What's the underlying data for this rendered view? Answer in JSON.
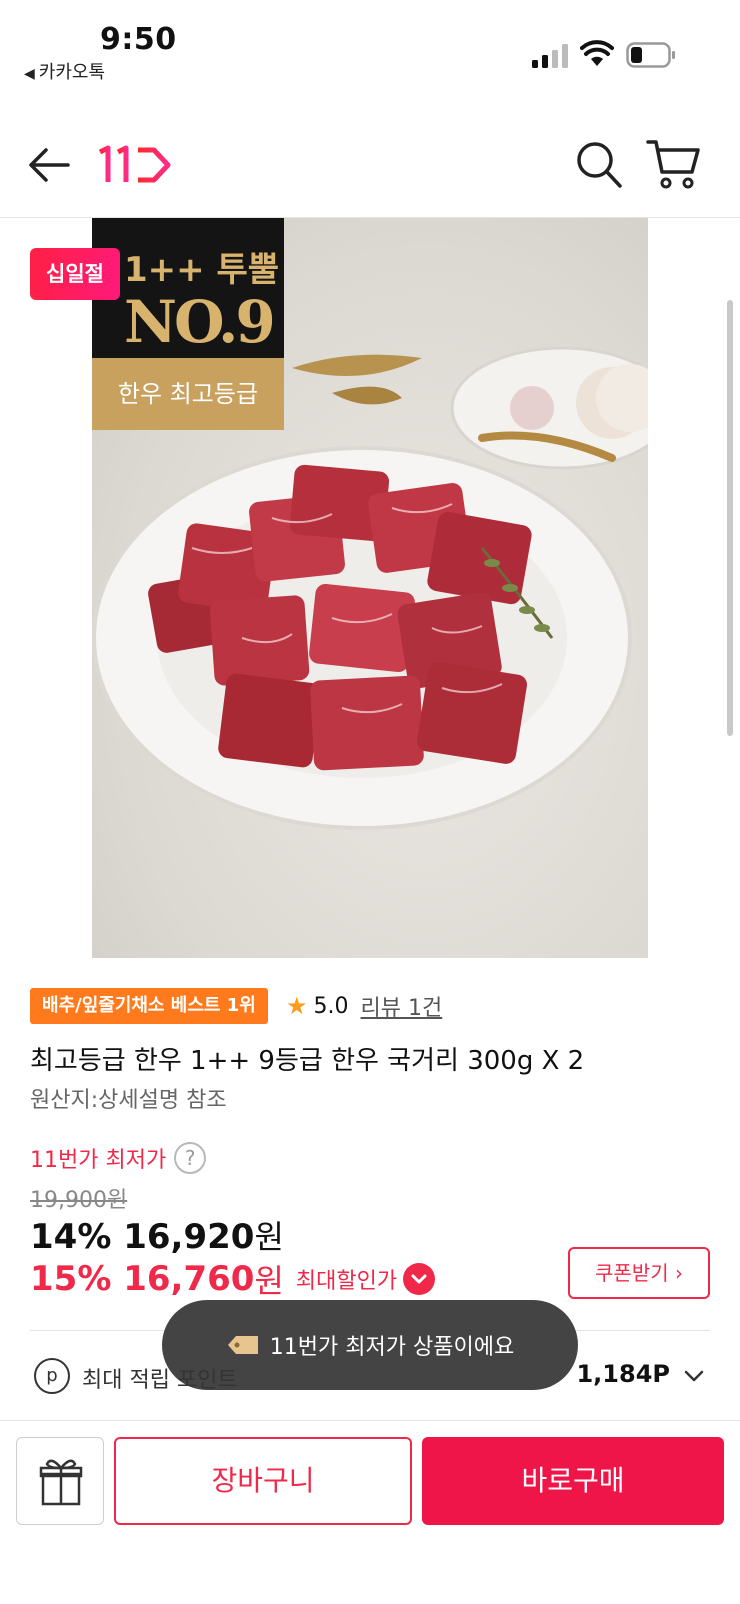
{
  "status_bar": {
    "time": "9:50",
    "back_app": "카카오톡"
  },
  "header": {
    "logo_text": "11"
  },
  "product_image": {
    "badge_line1": "1++ 투뿔",
    "badge_line2": "NO.9",
    "badge_line3": "한우 최고등급",
    "event_badge": "십일절"
  },
  "product": {
    "rank_badge": "배추/잎줄기채소 베스트 1위",
    "rating": "5.0",
    "review": "리뷰 1건",
    "title": "최고등급 한우 1++ 9등급 한우 국거리 300g X 2",
    "origin": "원산지:상세설명 참조"
  },
  "price": {
    "lowest_label": "11번가 최저가",
    "original": "19,900원",
    "discount1_pct": "14%",
    "discount1_price": "16,920",
    "discount2_pct": "15%",
    "discount2_price": "16,760",
    "won": "원",
    "max_discount_label": "최대할인가",
    "coupon_button": "쿠폰받기"
  },
  "points": {
    "label": "최대 적립 포인트",
    "value": "1,184P"
  },
  "toast": {
    "message": "11번가 최저가 상품이에요"
  },
  "bottom_bar": {
    "cart_button": "장바구니",
    "buy_button": "바로구매"
  },
  "colors": {
    "brand_red": "#f0294a",
    "rank_orange": "#ff7a1c",
    "star_orange": "#ff9d1a"
  }
}
